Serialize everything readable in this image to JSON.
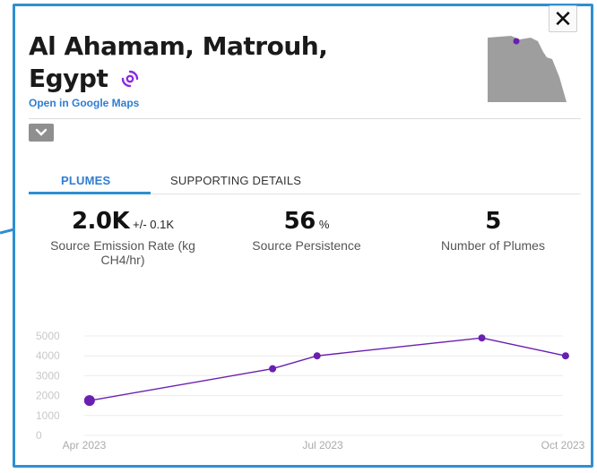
{
  "header": {
    "title_line1": "Al Ahamam, Matrouh,",
    "title_line2": "Egypt",
    "maps_link": "Open in Google Maps",
    "close_label": "✕"
  },
  "tabs": [
    {
      "label": "PLUMES",
      "active": true
    },
    {
      "label": "SUPPORTING DETAILS",
      "active": false
    }
  ],
  "stats": {
    "rate": {
      "value": "2.0K",
      "unit": "+/- 0.1K",
      "label": "Source Emission Rate (kg CH4/hr)"
    },
    "persistence": {
      "value": "56",
      "unit": "%",
      "label": "Source Persistence"
    },
    "plumes": {
      "value": "5",
      "label": "Number of Plumes"
    }
  },
  "colors": {
    "accent": "#2f8fd1",
    "series": "#6a1fb0"
  },
  "icons": [
    "close-icon",
    "plume-icon",
    "chevron-down-icon",
    "egypt-map"
  ],
  "chart_data": {
    "type": "line",
    "x_tick_labels": [
      "Apr 2023",
      "Jul 2023",
      "Oct 2023"
    ],
    "y_ticks": [
      0,
      1000,
      2000,
      3000,
      4000,
      5000
    ],
    "ylim": [
      0,
      5000
    ],
    "x_range": [
      "2023-04-01",
      "2023-10-01"
    ],
    "grid": true,
    "series": [
      {
        "points": [
          {
            "x": "2023-04-03",
            "y": 1750
          },
          {
            "x": "2023-06-12",
            "y": 3350
          },
          {
            "x": "2023-06-29",
            "y": 4000
          },
          {
            "x": "2023-08-31",
            "y": 4900
          },
          {
            "x": "2023-10-02",
            "y": 4000
          }
        ]
      }
    ]
  }
}
